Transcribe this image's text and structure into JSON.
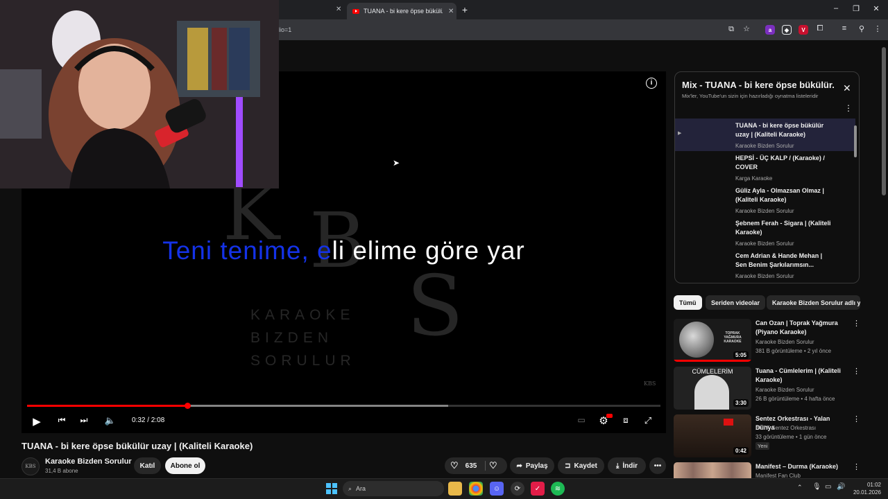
{
  "browser": {
    "active_tab_title": "TUANA - bi kere öpse bükülür uzay",
    "url_fragment": "dio=1",
    "close_glyph": "✕",
    "new_tab_glyph": "+"
  },
  "player": {
    "lyrics_sung": "Teni tenime, e",
    "lyrics_rest": "li elime göre yar",
    "watermark_letters": [
      "K",
      "B",
      "S"
    ],
    "watermark_text": [
      "KARAOKE",
      "BIZDEN",
      "SORULUR"
    ],
    "current_time": "0:32 / 2:08",
    "progress_fraction": 0.253,
    "buffered_fraction": 0.665
  },
  "video": {
    "title": "TUANA - bi kere öpse bükülür uzay | (Kaliteli Karaoke)",
    "channel_name": "Karaoke Bizden Sorulur",
    "subscribers": "31,4 B abone",
    "join_label": "Katıl",
    "subscribe_label": "Abone ol",
    "like_count": "635",
    "share_label": "Paylaş",
    "save_label": "Kaydet",
    "download_label": "İndir",
    "avatar_text": "KBS"
  },
  "playlist": {
    "title": "Mix - TUANA - bi kere öpse bükülür...",
    "subtitle": "Mix'ler, YouTube'un sizin için hazırladığı oynatma listeleridir",
    "items": [
      {
        "title": "TUANA - bi kere öpse bükülür uzay | (Kaliteli Karaoke)",
        "channel": "Karaoke Bizden Sorulur"
      },
      {
        "title": "HEPSİ - ÜÇ KALP / (Karaoke) / COVER",
        "channel": "Karga Karaoke"
      },
      {
        "title": "Güliz Ayla - Olmazsan Olmaz | (Kaliteli Karaoke)",
        "channel": "Karaoke Bizden Sorulur"
      },
      {
        "title": "Şebnem Ferah - Sigara | (Kaliteli Karaoke)",
        "channel": "Karaoke Bizden Sorulur"
      },
      {
        "title": "Cem Adrian & Hande Mehan | Sen Benim Şarkılarımsın...",
        "channel": "Karaoke Bizden Sorulur"
      }
    ]
  },
  "chips": [
    "Tümü",
    "Seriden videolar",
    "Karaoke Bizden Sorulur adlı yü"
  ],
  "recommendations": [
    {
      "title": "Can Ozan | Toprak Yağmura (Piyano Karaoke)",
      "channel": "Karaoke Bizden Sorulur",
      "meta": "381 B görüntüleme • 2 yıl önce",
      "duration": "5:05",
      "thumb_text": "TOPRAK YAĞMURA KARAOKE",
      "badge": ""
    },
    {
      "title": "Tuana - Cümlelerim | (Kaliteli Karaoke)",
      "channel": "Karaoke Bizden Sorulur",
      "meta": "26 B görüntüleme • 4 hafta önce",
      "duration": "3:30",
      "thumb_text": "CÜMLELERİM",
      "badge": ""
    },
    {
      "title": "Sentez Orkestrası - Yalan Dünya",
      "channel": "AÜTF Sentez Orkestrası",
      "meta": "33 görüntüleme • 1 gün önce",
      "duration": "0:42",
      "thumb_text": "",
      "badge": "Yeni"
    },
    {
      "title": "Manifest – Durma (Karaoke)",
      "channel": "Manifest Fan Club",
      "meta": "",
      "duration": "",
      "thumb_text": "",
      "badge": ""
    }
  ],
  "taskbar": {
    "search_placeholder": "Ara",
    "time": "01:02",
    "date": "20.01.2026"
  },
  "icons": {
    "more": "⋮",
    "close": "✕",
    "play": "▶",
    "like": "👍",
    "share": "➦",
    "download": "⤓",
    "save": "🔖",
    "search": "🔍"
  }
}
